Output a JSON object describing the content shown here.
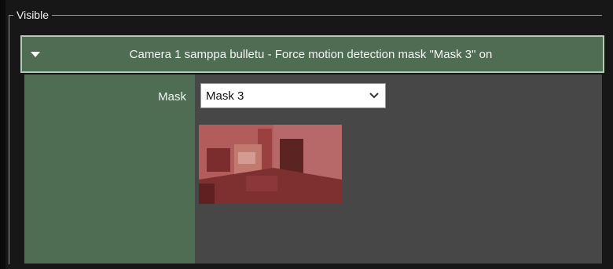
{
  "groupbox": {
    "label": "Visible"
  },
  "section": {
    "title": "Camera 1 samppa bulletu - Force motion detection mask \"Mask 3\" on",
    "toggle_icon": "chevron-down-icon"
  },
  "form": {
    "mask_label": "Mask",
    "mask_select": {
      "value": "Mask 3",
      "icon": "chevron-down-icon"
    }
  },
  "preview": {
    "kind": "camera snapshot with red motion mask overlay",
    "tint": "#9a3a3a"
  },
  "colors": {
    "panel_green": "#4e6d52",
    "panel_gray": "#474747",
    "background": "#171717"
  }
}
